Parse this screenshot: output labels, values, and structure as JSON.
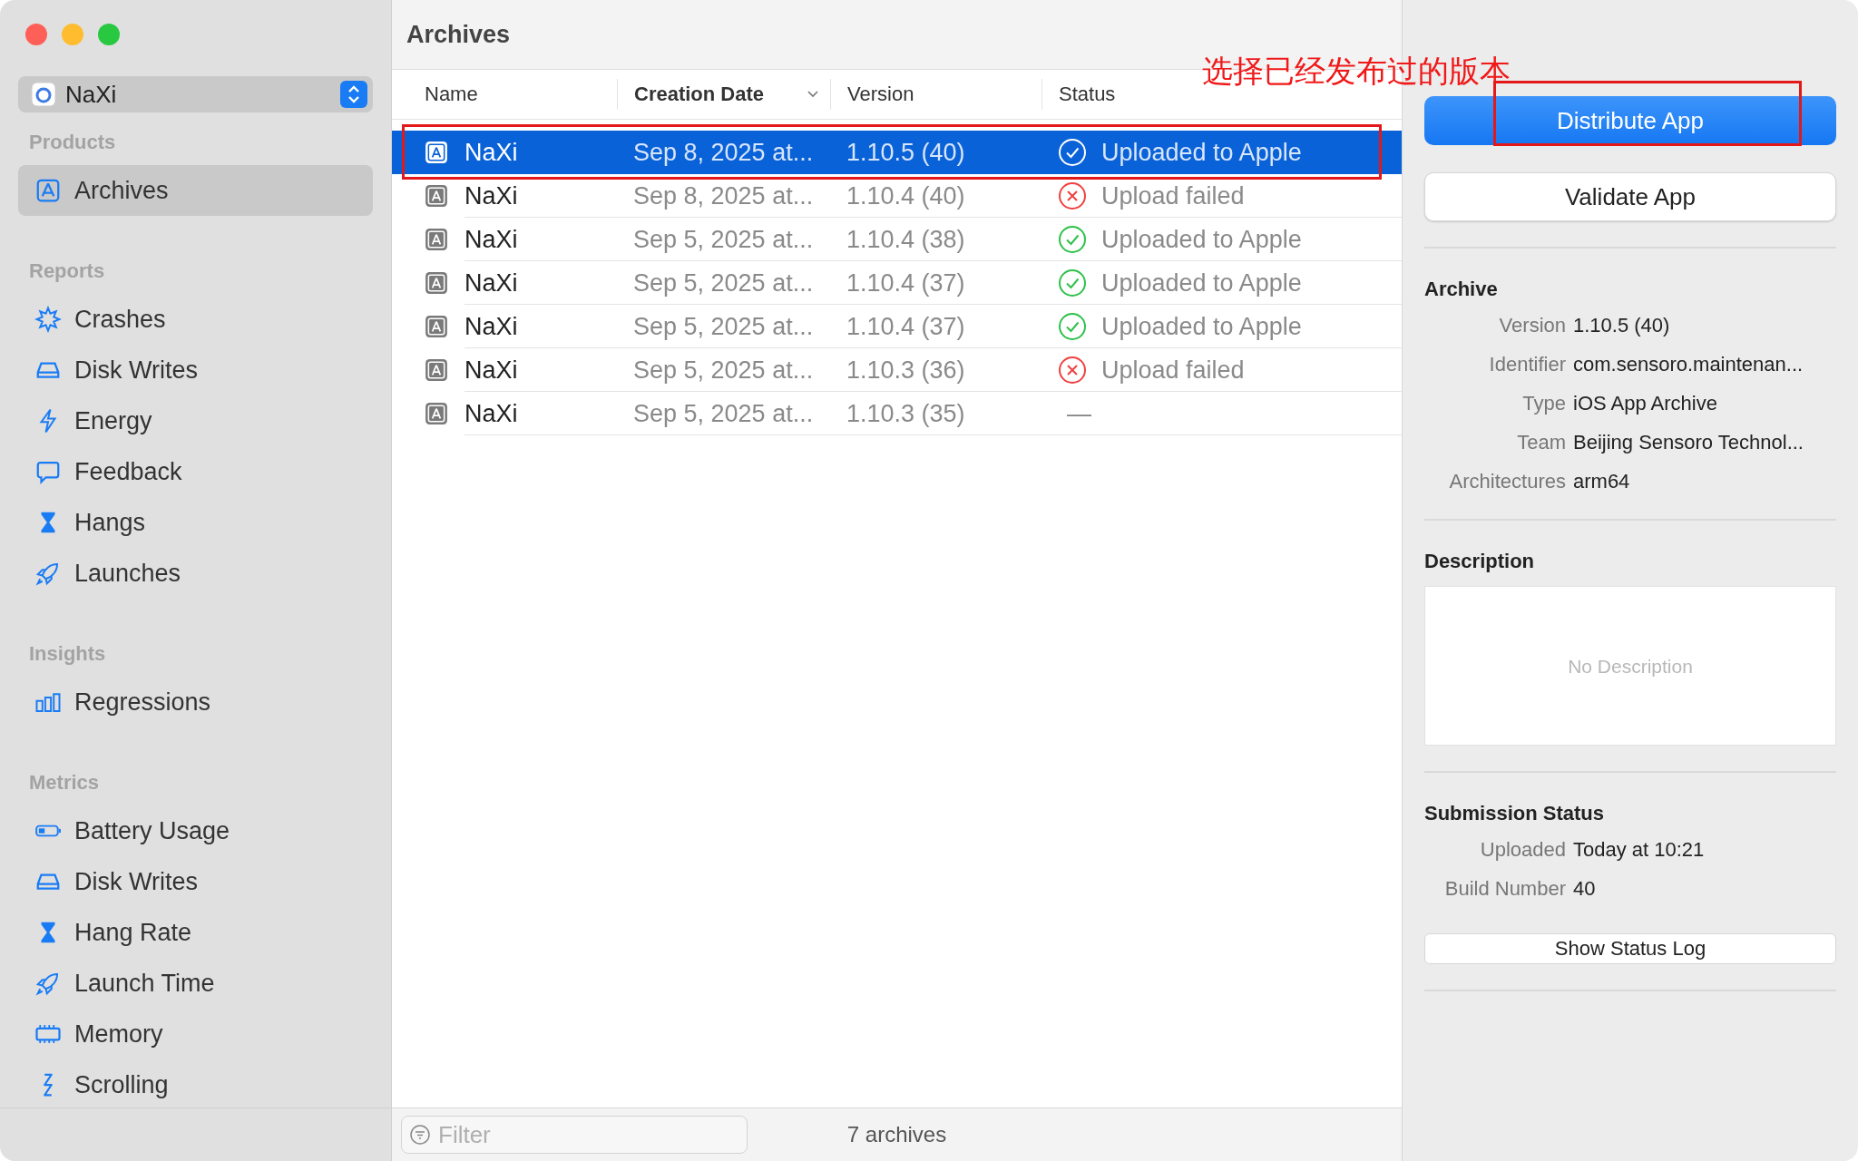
{
  "sidebar": {
    "product": {
      "name": "NaXi"
    },
    "sections": [
      {
        "label": "Products",
        "items": [
          {
            "label": "Archives",
            "kind": "archive",
            "selected": true
          }
        ]
      },
      {
        "label": "Reports",
        "items": [
          {
            "label": "Crashes",
            "kind": "crash",
            "selected": false
          },
          {
            "label": "Disk Writes",
            "kind": "disk",
            "selected": false
          },
          {
            "label": "Energy",
            "kind": "bolt",
            "selected": false
          },
          {
            "label": "Feedback",
            "kind": "bubble",
            "selected": false
          },
          {
            "label": "Hangs",
            "kind": "hourglass",
            "selected": false
          },
          {
            "label": "Launches",
            "kind": "rocket",
            "selected": false
          }
        ]
      },
      {
        "label": "Insights",
        "items": [
          {
            "label": "Regressions",
            "kind": "bars",
            "selected": false
          }
        ]
      },
      {
        "label": "Metrics",
        "items": [
          {
            "label": "Battery Usage",
            "kind": "battery",
            "selected": false
          },
          {
            "label": "Disk Writes",
            "kind": "disk",
            "selected": false
          },
          {
            "label": "Hang Rate",
            "kind": "hourglass",
            "selected": false
          },
          {
            "label": "Launch Time",
            "kind": "rocket",
            "selected": false
          },
          {
            "label": "Memory",
            "kind": "chip",
            "selected": false
          },
          {
            "label": "Scrolling",
            "kind": "scroll",
            "selected": false
          }
        ]
      }
    ]
  },
  "archives": {
    "title": "Archives",
    "columns": [
      {
        "label": "Name",
        "sorted": false
      },
      {
        "label": "Creation Date",
        "sorted": true
      },
      {
        "label": "Version",
        "sorted": false
      },
      {
        "label": "Status",
        "sorted": false
      }
    ],
    "rows": [
      {
        "name": "NaXi",
        "date": "Sep 8, 2025 at...",
        "version": "1.10.5 (40)",
        "status": {
          "kind": "uploaded",
          "text": "Uploaded to Apple"
        },
        "selected": true
      },
      {
        "name": "NaXi",
        "date": "Sep 8, 2025 at...",
        "version": "1.10.4 (40)",
        "status": {
          "kind": "failed",
          "text": "Upload failed"
        },
        "selected": false
      },
      {
        "name": "NaXi",
        "date": "Sep 5, 2025 at...",
        "version": "1.10.4 (38)",
        "status": {
          "kind": "uploaded",
          "text": "Uploaded to Apple"
        },
        "selected": false
      },
      {
        "name": "NaXi",
        "date": "Sep 5, 2025 at...",
        "version": "1.10.4 (37)",
        "status": {
          "kind": "uploaded",
          "text": "Uploaded to Apple"
        },
        "selected": false
      },
      {
        "name": "NaXi",
        "date": "Sep 5, 2025 at...",
        "version": "1.10.4 (37)",
        "status": {
          "kind": "uploaded",
          "text": "Uploaded to Apple"
        },
        "selected": false
      },
      {
        "name": "NaXi",
        "date": "Sep 5, 2025 at...",
        "version": "1.10.3 (36)",
        "status": {
          "kind": "failed",
          "text": "Upload failed"
        },
        "selected": false
      },
      {
        "name": "NaXi",
        "date": "Sep 5, 2025 at...",
        "version": "1.10.3 (35)",
        "status": {
          "kind": "none",
          "text": "—"
        },
        "selected": false
      }
    ],
    "filter": {
      "placeholder": "Filter"
    },
    "count": "7 archives"
  },
  "inspector": {
    "primary_button": "Distribute App",
    "secondary_button": "Validate App",
    "archive": {
      "title": "Archive",
      "fields": [
        {
          "key": "Version",
          "value": "1.10.5 (40)"
        },
        {
          "key": "Identifier",
          "value": "com.sensoro.maintenan..."
        },
        {
          "key": "Type",
          "value": "iOS App Archive"
        },
        {
          "key": "Team",
          "value": "Beijing Sensoro Technol..."
        },
        {
          "key": "Architectures",
          "value": "arm64"
        }
      ]
    },
    "description": {
      "title": "Description",
      "placeholder": "No Description"
    },
    "submission": {
      "title": "Submission Status",
      "fields": [
        {
          "key": "Uploaded",
          "value": "Today at 10:21"
        },
        {
          "key": "Build Number",
          "value": "40"
        }
      ]
    },
    "log_button": "Show Status Log"
  },
  "annotation": {
    "text": "选择已经发布过的版本"
  }
}
